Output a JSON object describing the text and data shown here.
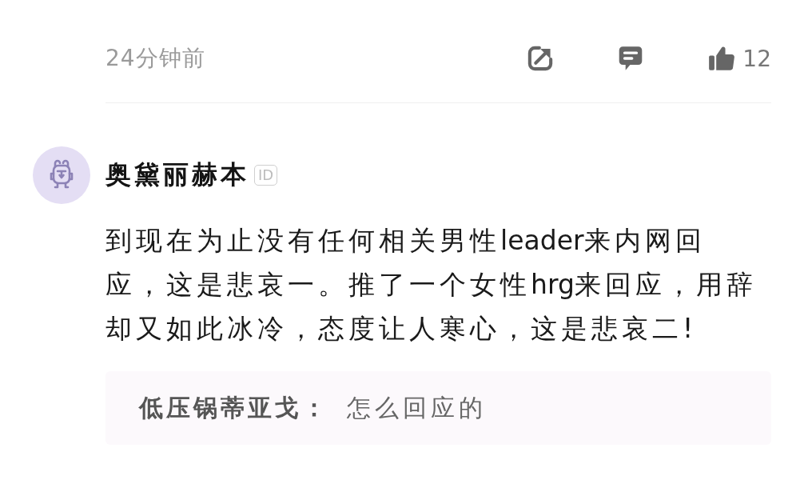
{
  "previous_comment_footer": {
    "time": "24分钟前",
    "like_count": "12"
  },
  "comment": {
    "author": "奥黛丽赫本",
    "badge": "ID",
    "text": "到现在为止没有任何相关男性leader来内网回应，这是悲哀一。推了一个女性hrg来回应，用辞却又如此冰冷，态度让人寒心，这是悲哀二!",
    "replies": [
      {
        "author": "低压锅蒂亚戈：",
        "text": "怎么回应的"
      }
    ]
  }
}
